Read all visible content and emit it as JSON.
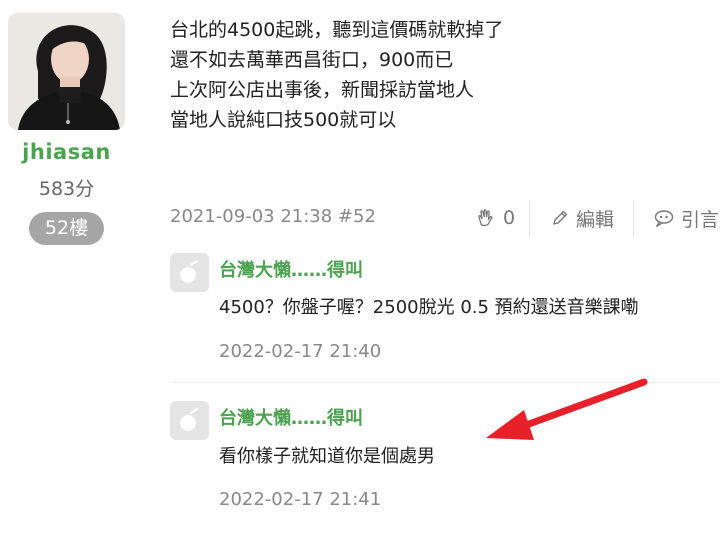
{
  "user": {
    "name": "jhiasan",
    "points": "583分",
    "floor": "52樓"
  },
  "post": {
    "lines": [
      "台北的4500起跳，聽到這價碼就軟掉了",
      "還不如去萬華西昌街口，900而已",
      "上次阿公店出事後，新聞採訪當地人",
      "當地人說純口技500就可以"
    ],
    "meta": "2021-09-03 21:38 #52"
  },
  "actions": {
    "like_count": "0",
    "edit_label": "編輯",
    "quote_label": "引言"
  },
  "comments": [
    {
      "author": "台灣大懶……得叫",
      "text": "4500？你盤子喔？2500脫光 0.5 預約還送音樂課嘞",
      "time": "2022-02-17 21:40"
    },
    {
      "author": "台灣大懶……得叫",
      "text": "看你樣子就知道你是個處男",
      "time": "2022-02-17 21:41"
    }
  ],
  "colors": {
    "username": "#4ca24f",
    "badge": "#a6a6a6",
    "arrow": "#e8202a"
  },
  "icons": [
    "avatar-photo",
    "clap-icon",
    "pencil-icon",
    "quote-icon",
    "default-avatar-icon",
    "arrow-annotation"
  ]
}
